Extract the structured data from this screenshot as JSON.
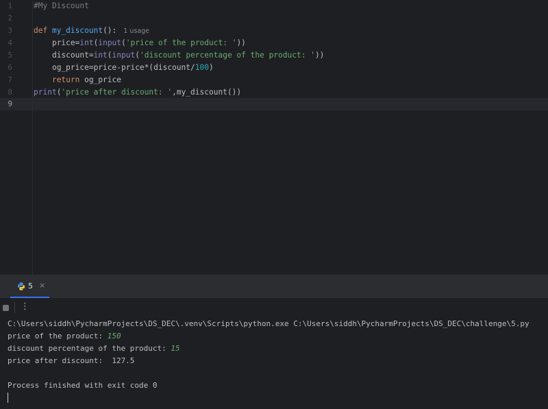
{
  "editor": {
    "line_numbers": [
      "1",
      "2",
      "3",
      "4",
      "5",
      "6",
      "7",
      "8",
      "9"
    ],
    "code": {
      "l1_comment": "#My Discount",
      "l3_def": "def",
      "l3_name": "my_discount",
      "l3_paren": "():",
      "l3_usage": "1 usage",
      "l4_a": "price=",
      "l4_int": "int",
      "l4_b": "(",
      "l4_input": "input",
      "l4_c": "(",
      "l4_str": "'price of the product: '",
      "l4_d": "))",
      "l5_a": "discount=",
      "l5_int": "int",
      "l5_b": "(",
      "l5_input": "input",
      "l5_c": "(",
      "l5_str": "'discount percentage of the product: '",
      "l5_d": "))",
      "l6_a": "og_price=price-price*(discount/",
      "l6_num": "100",
      "l6_b": ")",
      "l7_return": "return",
      "l7_a": " og_price",
      "l8_print": "print",
      "l8_a": "(",
      "l8_str": "'price after discount: '",
      "l8_b": ",my_discount())"
    }
  },
  "run_panel": {
    "tab_label": "5",
    "tab_close": "×",
    "more_label": "⋮",
    "console": {
      "command": "C:\\Users\\siddh\\PycharmProjects\\DS_DEC\\.venv\\Scripts\\python.exe C:\\Users\\siddh\\PycharmProjects\\DS_DEC\\challenge\\5.py",
      "prompt1": "price of the product: ",
      "input1": "150",
      "prompt2": "discount percentage of the product: ",
      "input2": "15",
      "result": "price after discount:  127.5",
      "exit": "Process finished with exit code 0"
    }
  },
  "colors": {
    "background": "#1e1f22",
    "keyword": "#cf8e6d",
    "function": "#56a8f5",
    "builtin": "#8888c6",
    "string": "#6aab73",
    "number": "#2aacb8",
    "comment": "#7a7e85",
    "accent": "#3574f0"
  },
  "icons": {
    "run_tab": "python-icon",
    "stop": "stop-icon",
    "more": "more-vertical-icon"
  }
}
